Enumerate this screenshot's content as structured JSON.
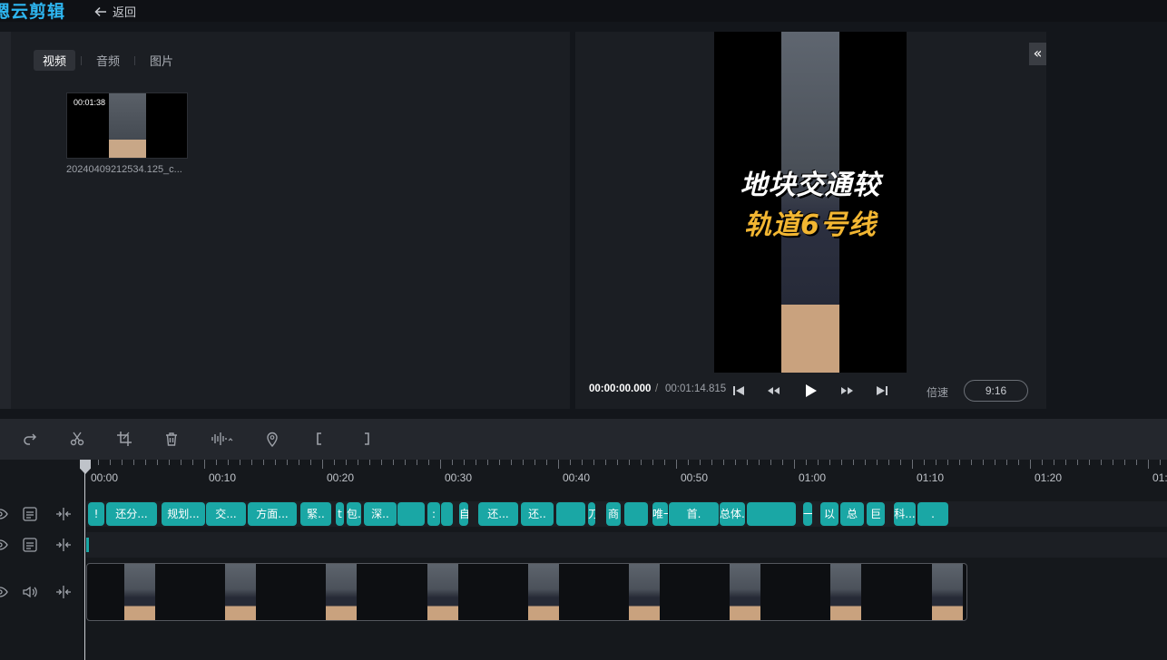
{
  "app": {
    "logo": "云剪辑",
    "logo_partial_left": "嗯",
    "back_label": "返回"
  },
  "media_panel": {
    "tabs": [
      {
        "label": "视频",
        "active": true
      },
      {
        "label": "音频",
        "active": false
      },
      {
        "label": "图片",
        "active": false
      }
    ],
    "clips": [
      {
        "duration": "00:01:38",
        "name": "20240409212534.125_c..."
      }
    ]
  },
  "preview": {
    "caption_line1": "地块交通较",
    "caption_line2": "轨道6号线",
    "current_time": "00:00:00.000",
    "separator": "/",
    "total_time": "00:01:14.815",
    "speed_label": "倍速",
    "aspect_ratio": "9:16",
    "collapse_glyph": "«"
  },
  "timeline": {
    "ruler_labels": [
      "00:00",
      "00:10",
      "00:20",
      "00:30",
      "00:40",
      "00:50",
      "01:00",
      "01:10",
      "01:20",
      "01:3"
    ],
    "subtitle_clips": [
      "!",
      "还分...",
      "规划...",
      "交...",
      "方面...",
      "緊..",
      "t",
      "包...",
      "深..",
      "",
      ":",
      "",
      "自..",
      "还...",
      "还..",
      "",
      "刀",
      "商",
      "",
      "唯一...",
      "首.",
      "总体...",
      "",
      "一",
      "以",
      "总",
      "巨",
      "科...",
      "."
    ]
  },
  "colors": {
    "accent": "#2eb6f0",
    "subtitle_clip": "#1aa7a5",
    "caption_yellow": "#f2b632"
  }
}
